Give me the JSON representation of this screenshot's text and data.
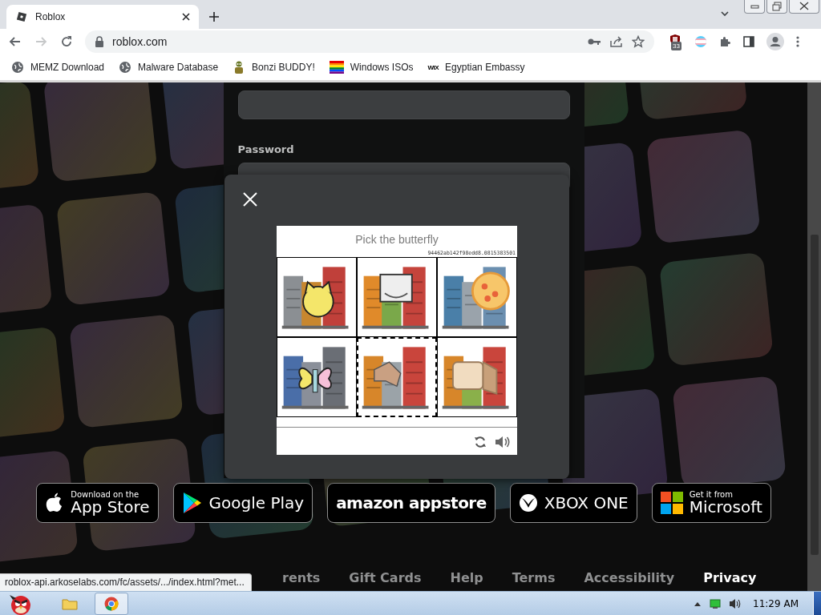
{
  "browser": {
    "tabs": [
      {
        "title": "Roblox",
        "selected": true
      }
    ],
    "nav": {
      "back_disabled": false,
      "forward_disabled": true
    },
    "address": "roblox.com",
    "extension_badge": "33",
    "bookmarks": [
      {
        "kind": "globe",
        "label": "MEMZ Download"
      },
      {
        "kind": "globe",
        "label": "Malware Database"
      },
      {
        "kind": "figure",
        "label": "Bonzi BUDDY!"
      },
      {
        "kind": "flag",
        "label": "Windows ISOs"
      },
      {
        "kind": "wix",
        "icon_text": "WIX",
        "label": "Egyptian Embassy"
      }
    ]
  },
  "login": {
    "password_label": "Password"
  },
  "captcha": {
    "title": "Pick the butterfly",
    "token": "94462ab142f98edd8.0815383501",
    "images": [
      {
        "selected": false
      },
      {
        "selected": false
      },
      {
        "selected": false
      },
      {
        "selected": false
      },
      {
        "selected": true
      },
      {
        "selected": false
      }
    ]
  },
  "store_badges": [
    {
      "kind": "apple",
      "line1": "Download on the",
      "line2": "App Store"
    },
    {
      "kind": "google",
      "line2": "Google Play"
    },
    {
      "kind": "amazon",
      "line2": "amazon appstore"
    },
    {
      "kind": "xbox",
      "line2": "XBOX ONE"
    },
    {
      "kind": "microsoft",
      "line1": "Get it from",
      "line2": "Microsoft"
    }
  ],
  "footer": {
    "links": [
      {
        "label": "rents",
        "current": false
      },
      {
        "label": "Gift Cards",
        "current": false
      },
      {
        "label": "Help",
        "current": false
      },
      {
        "label": "Terms",
        "current": false
      },
      {
        "label": "Accessibility",
        "current": false
      },
      {
        "label": "Privacy",
        "current": true
      }
    ]
  },
  "status_url": "roblox-api.arkoselabs.com/fc/assets/.../index.html?met...",
  "taskbar": {
    "apps": [
      {
        "kind": "folder",
        "active": false
      },
      {
        "kind": "chrome",
        "active": true
      }
    ],
    "clock": "11:29 AM"
  }
}
